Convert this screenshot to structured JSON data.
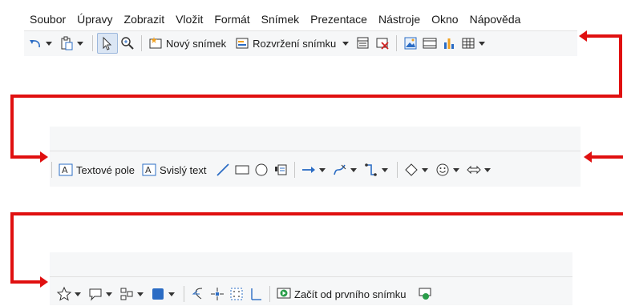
{
  "menu": [
    "Soubor",
    "Úpravy",
    "Zobrazit",
    "Vložit",
    "Formát",
    "Snímek",
    "Prezentace",
    "Nástroje",
    "Okno",
    "Nápověda"
  ],
  "toolbar1": {
    "new_slide": "Nový snímek",
    "slide_layout": "Rozvržení snímku"
  },
  "toolbar2": {
    "text_box": "Textové pole",
    "vertical_text": "Svislý text"
  },
  "toolbar3": {
    "start_first_slide": "Začít od prvního snímku"
  },
  "colors": {
    "arrow": "#e01010",
    "accent_blue": "#2b6cc4"
  }
}
